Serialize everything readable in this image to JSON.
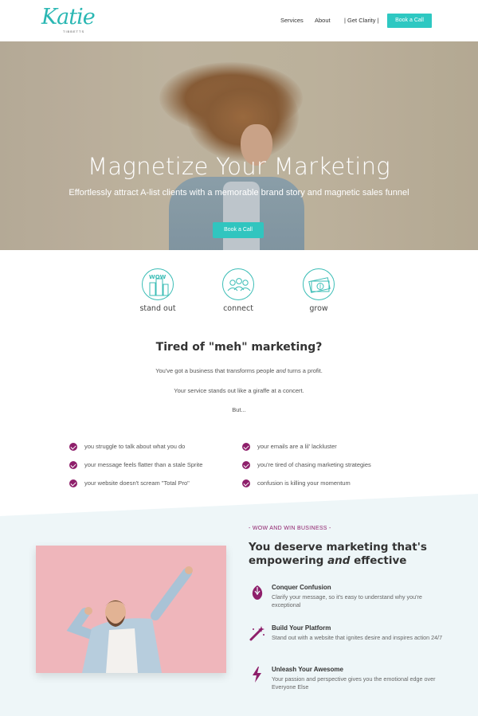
{
  "header": {
    "logo_script": "Katie",
    "logo_sub": "TIBBETTS",
    "nav": [
      {
        "label": "Services"
      },
      {
        "label": "About"
      },
      {
        "label": "| Get Clarity |"
      }
    ],
    "cta_label": "Book a Call"
  },
  "hero": {
    "title": "Magnetize Your Marketing",
    "subtitle": "Effortlessly attract A-list clients with a memorable brand story and magnetic sales funnel",
    "cta_label": "Book a Call"
  },
  "features": [
    {
      "label": "stand out",
      "icon": "wow-buildings-icon",
      "icon_text": "WOW"
    },
    {
      "label": "connect",
      "icon": "people-group-icon"
    },
    {
      "label": "grow",
      "icon": "money-icon"
    }
  ],
  "pain": {
    "title": "Tired of \"meh\" marketing?",
    "line1_pre": "You've got a business that transforms people ",
    "line1_em": "and",
    "line1_post": " turns a profit.",
    "line2": "Your service stands out like a giraffe at a concert.",
    "line3": "But...",
    "left_items": [
      "you struggle to talk about what you do",
      "your message feels flatter than a stale Sprite",
      "your website doesn't scream \"Total Pro\""
    ],
    "right_items": [
      "your emails are a lil' lackluster",
      "you're tired of chasing marketing strategies",
      "confusion is killing your momentum"
    ]
  },
  "empower": {
    "tagline": "- WOW AND WIN BUSINESS -",
    "title_line1": "You deserve marketing that's",
    "title_line2_pre": "empowering ",
    "title_line2_em": "and",
    "title_line2_post": " effective",
    "benefits": [
      {
        "title": "Conquer Confusion",
        "text": "Clarify your message, so it's easy to understand why you're exceptional",
        "icon": "rebel-emblem-icon"
      },
      {
        "title": "Build Your Platform",
        "text": "Stand out with a website that ignites desire and inspires action 24/7",
        "icon": "magic-wand-icon"
      },
      {
        "title": "Unleash Your Awesome",
        "text": "Your passion and perspective gives you the emotional edge over Everyone Else",
        "icon": "lightning-bolt-icon"
      }
    ]
  },
  "colors": {
    "accent": "#2ec8c2",
    "brand_purple": "#8e1f6b",
    "lower_bg": "#eef6f8",
    "photo_pink": "#efb6bb"
  }
}
